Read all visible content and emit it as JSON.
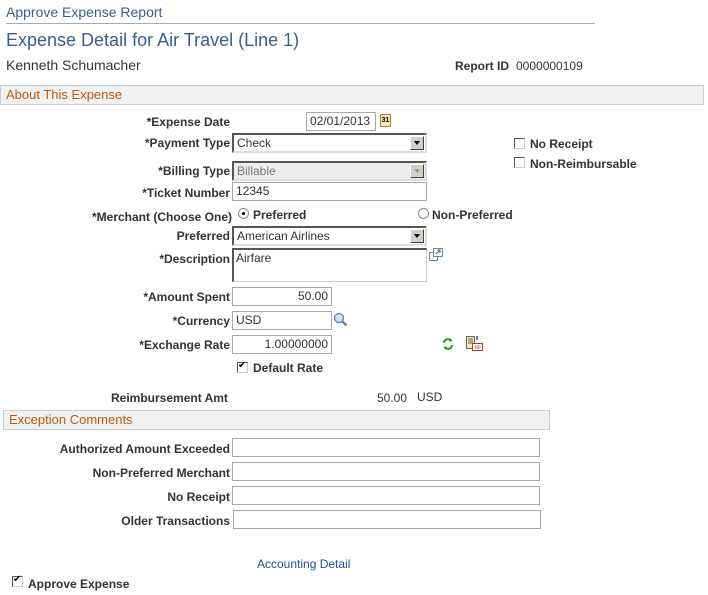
{
  "breadcrumb": "Approve Expense Report",
  "page_title": "Expense Detail for Air Travel (Line 1)",
  "employee_name": "Kenneth Schumacher",
  "report_id": {
    "label": "Report ID",
    "value": "0000000109"
  },
  "about_section": {
    "title": "About This Expense",
    "expense_date": {
      "label": "*Expense Date",
      "value": "02/01/2013",
      "icon": "calendar-icon"
    },
    "payment_type": {
      "label": "*Payment Type",
      "value": "Check"
    },
    "billing_type": {
      "label": "*Billing Type",
      "value": "Billable",
      "disabled": true
    },
    "ticket_number": {
      "label": "*Ticket Number",
      "value": "12345"
    },
    "merchant": {
      "label": "*Merchant (Choose One)",
      "options": [
        {
          "label": "Preferred",
          "selected": true
        },
        {
          "label": "Non-Preferred",
          "selected": false
        }
      ]
    },
    "preferred": {
      "label": "Preferred",
      "value": "American Airlines"
    },
    "description": {
      "label": "*Description",
      "value": "Airfare",
      "icon": "expand-icon"
    },
    "amount_spent": {
      "label": "*Amount Spent",
      "value": "50.00"
    },
    "currency": {
      "label": "*Currency",
      "value": "USD",
      "icon": "lookup-icon"
    },
    "exchange_rate": {
      "label": "*Exchange Rate",
      "value": "1.00000000"
    },
    "default_rate": {
      "label": "Default Rate",
      "checked": true
    },
    "no_receipt": {
      "label": "No Receipt",
      "checked": false
    },
    "non_reimbursable": {
      "label": "Non-Reimbursable",
      "checked": false
    },
    "reimbursement": {
      "label": "Reimbursement Amt",
      "value": "50.00",
      "currency": "USD"
    }
  },
  "exception_section": {
    "title": "Exception Comments",
    "fields": [
      {
        "label": "Authorized Amount Exceeded",
        "value": ""
      },
      {
        "label": "Non-Preferred Merchant",
        "value": ""
      },
      {
        "label": "No Receipt",
        "value": ""
      },
      {
        "label": "Older Transactions",
        "value": ""
      }
    ]
  },
  "accounting_detail_link": "Accounting Detail",
  "approve_expense": {
    "label": "Approve Expense",
    "checked": true
  },
  "colors": {
    "title_blue": "#3a5e8c",
    "section_orange": "#b85a0e",
    "section_bg": "#f0f2f2",
    "link_blue": "#1f4f8f"
  }
}
